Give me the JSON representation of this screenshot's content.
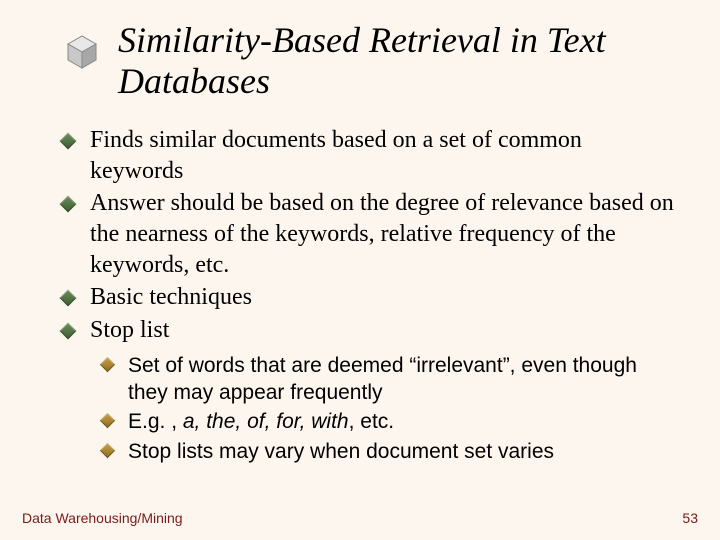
{
  "title": "Similarity-Based Retrieval in Text Databases",
  "bullets": [
    {
      "text": "Finds similar documents based on a set of common keywords"
    },
    {
      "text": "Answer should be based on the degree of relevance based on the nearness of the keywords, relative frequency of the keywords, etc."
    },
    {
      "text": "Basic techniques"
    },
    {
      "text": "Stop list"
    }
  ],
  "sub_bullets": [
    {
      "text": "Set of words that are deemed “irrelevant”, even though they may appear frequently"
    },
    {
      "prefix": "E.g. , ",
      "italic": "a, the, of, for, with",
      "suffix": ", etc."
    },
    {
      "text": "Stop lists may vary when document set varies"
    }
  ],
  "footer": {
    "left": "Data Warehousing/Mining",
    "right": "53"
  },
  "colors": {
    "background": "#fdf6ee",
    "footer_text": "#7a1a1a",
    "main_bullet": "#3d5a2f",
    "sub_bullet": "#8a6a1f"
  }
}
